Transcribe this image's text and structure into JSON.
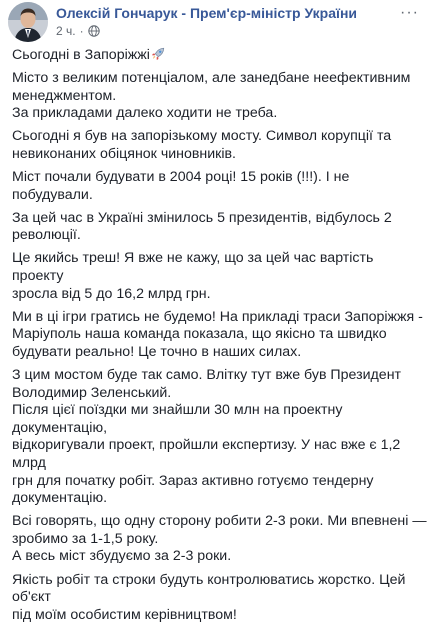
{
  "post": {
    "author": "Олексій Гончарук - Прем'єр-міністр України",
    "time": "2 ч.",
    "meta_separator": "·",
    "more_glyph": "···",
    "icons": {
      "audience": "globe-icon",
      "emoji": "rocket-icon",
      "menu": "more-options-icon"
    },
    "colors": {
      "author": "#385898",
      "meta": "#606770",
      "text": "#1d2129"
    },
    "lines": [
      "Сьогодні в Запоріжжі",
      "Місто з великим потенціалом, але занедбане неефективним",
      "менеджментом.",
      "За прикладами далеко ходити не треба.",
      "Сьогодні я був на запорізькому мосту. Символ корупції та",
      "невиконаних обіцянок чиновників.",
      "Міст почали будувати в 2004 році! 15 років (!!!). І не побудували.",
      "За цей час в Україні змінилось 5 президентів, відбулось 2",
      "революції.",
      "Це якийсь треш! Я вже не кажу, що за цей час вартість проекту",
      "зросла від 5 до 16,2 млрд грн.",
      "Ми в ці ігри гратись не будемо! На прикладі траси Запоріжжя -",
      "Маріуполь наша команда показала, що якісно та швидко",
      "будувати реально! Це точно в наших силах.",
      "З цим мостом буде так само. Влітку тут вже був Президент",
      "Володимир Зеленський.",
      "Після цієї поїздки ми знайшли 30 млн на проектну документацію,",
      "відкоригували проект, пройшли експертизу. У нас вже є 1,2 млрд",
      "грн для початку робіт. Зараз активно готуємо тендерну",
      "документацію.",
      "Всі говорять, що одну сторону робити 2-3 роки. Ми впевнені —",
      "зробимо за 1-1,5 року.",
      "А весь міст збудуємо за 2-3 роки.",
      "Якість робіт та строки будуть контролюватись жорстко. Цей об'єкт",
      "під моїм особистим керівництвом!"
    ]
  }
}
